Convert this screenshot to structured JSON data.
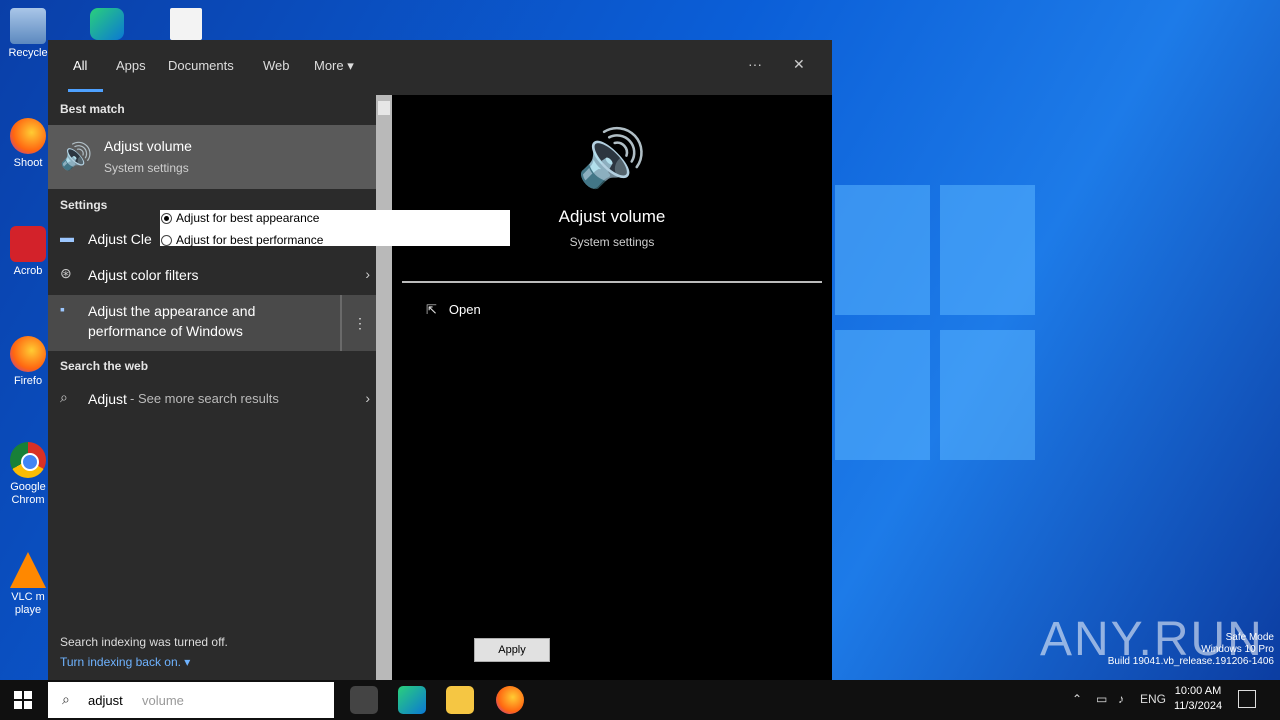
{
  "desktop": {
    "icons": [
      {
        "label": "Recycle"
      },
      {
        "label": "Shoot"
      },
      {
        "label": "Acrob"
      },
      {
        "label": "Firefo"
      },
      {
        "label": "Google Chrom"
      },
      {
        "label": "VLC m playe"
      }
    ]
  },
  "search_window": {
    "tabs": [
      {
        "label": "All"
      },
      {
        "label": "Apps"
      },
      {
        "label": "Documents"
      },
      {
        "label": "Web"
      },
      {
        "label": "More ▾"
      }
    ],
    "more_options_label": "···",
    "close_label": "✕",
    "best_match": {
      "heading": "Best match",
      "title": "Adjust volume",
      "subtitle": "System settings"
    },
    "settings": {
      "heading": "Settings",
      "items": [
        {
          "label": "Adjust Cle"
        },
        {
          "label": "Adjust color filters"
        },
        {
          "label": "Adjust the appearance and",
          "sublabel": "performance of Windows"
        }
      ],
      "more_label": "⋮"
    },
    "web": {
      "heading": "Search the web",
      "query": "Adjust",
      "hint": "- See more search results"
    },
    "footer": {
      "text": "Search indexing was turned off.",
      "link": "Turn indexing back on. ▾"
    },
    "preview": {
      "title": "Adjust volume",
      "subtitle": "System settings",
      "open_label": "Open"
    }
  },
  "performance_popup": {
    "options": [
      {
        "label": "Adjust for best appearance",
        "selected": true
      },
      {
        "label": "Adjust for best performance",
        "selected": false
      }
    ],
    "apply_label": "Apply"
  },
  "taskbar": {
    "search_text": "adjust",
    "search_hint": "volume",
    "tray_lang": "ENG",
    "clock_time": "10:00 AM",
    "clock_date": "11/3/2024"
  },
  "overlay": {
    "watermark": "ANY.RUN",
    "safe_mode_lines": [
      "Safe Mode",
      "Windows 10 Pro",
      "Build 19041.vb_release.191206-1406"
    ]
  },
  "colors": {
    "accent": "#4ea1ff",
    "panel_dark": "#2b2b2b",
    "preview_bg": "#000000",
    "desktop_blue": "#0b5fd8"
  }
}
